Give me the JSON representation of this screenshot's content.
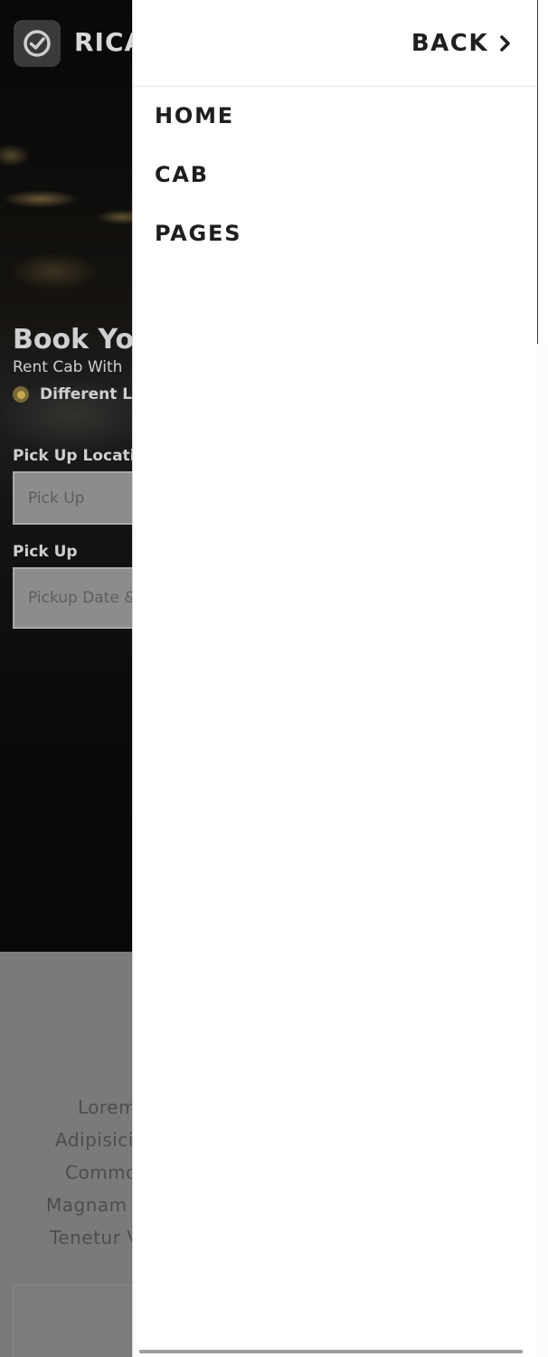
{
  "background_page": {
    "brand_name": "RICA",
    "hero_title": "Book You",
    "hero_subtitle": "Rent Cab With",
    "radio_option_label": "Different Lo",
    "pickup_location_label": "Pick Up Locatic",
    "pickup_location_placeholder": "Pick Up",
    "pickup_date_label": "Pick Up",
    "pickup_date_placeholder": "Pickup Date &",
    "lorem_lines": [
      "Lorem",
      "Adipisici",
      "Commo",
      "Magnam",
      "Tenetur V"
    ]
  },
  "drawer": {
    "back_label": "BACK",
    "back_icon": "chevron-right-icon",
    "menu_items": [
      "HOME",
      "CAB",
      "PAGES"
    ]
  },
  "colors": {
    "accent_gold": "#c9a74c",
    "drawer_bg": "#ffffff",
    "text_dark": "#1e1e1e"
  }
}
